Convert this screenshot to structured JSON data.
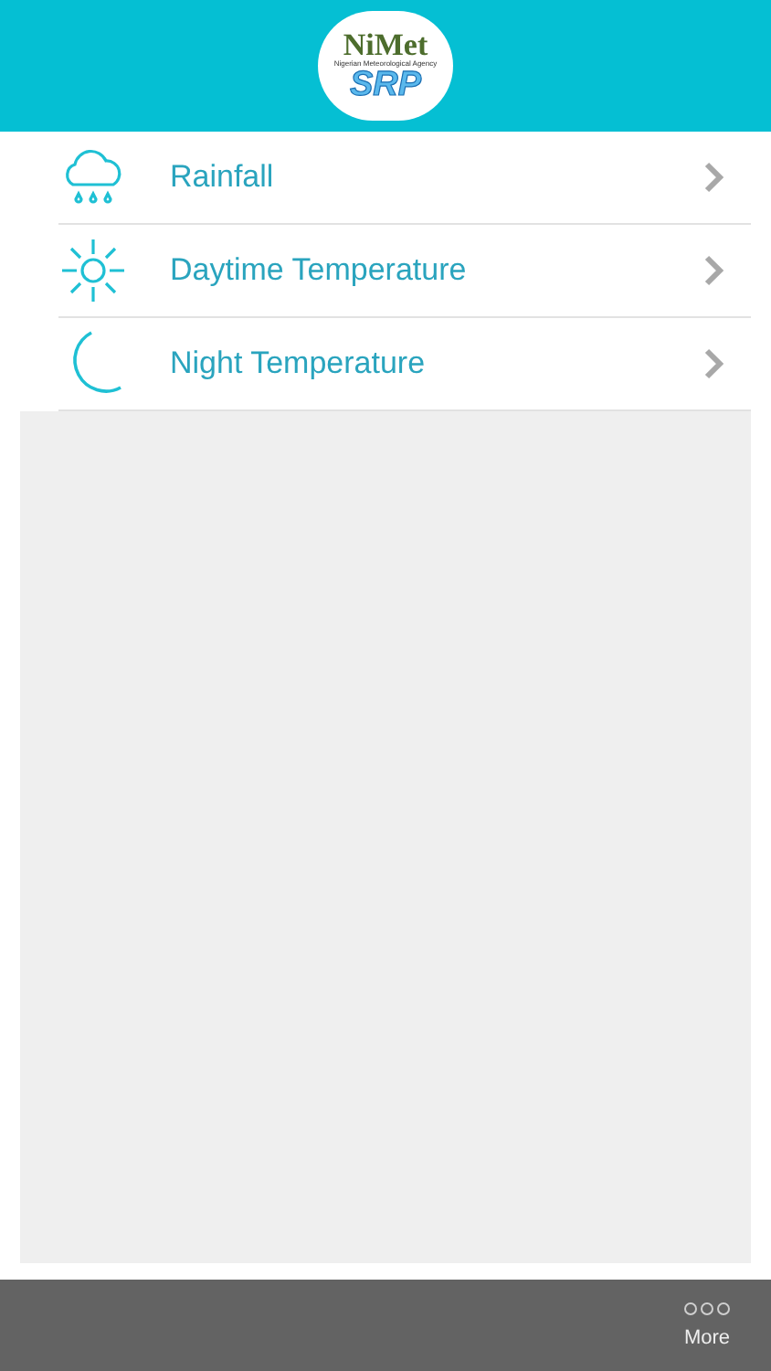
{
  "header": {
    "logo": {
      "name": "NiMet",
      "tagline": "Nigerian Meteorological Agency",
      "product": "SRP"
    }
  },
  "menu": [
    {
      "kind": "rain",
      "label": "Rainfall"
    },
    {
      "kind": "sun",
      "label": "Daytime Temperature"
    },
    {
      "kind": "moon",
      "label": "Night Temperature"
    }
  ],
  "tab_bar": {
    "more": "More"
  }
}
